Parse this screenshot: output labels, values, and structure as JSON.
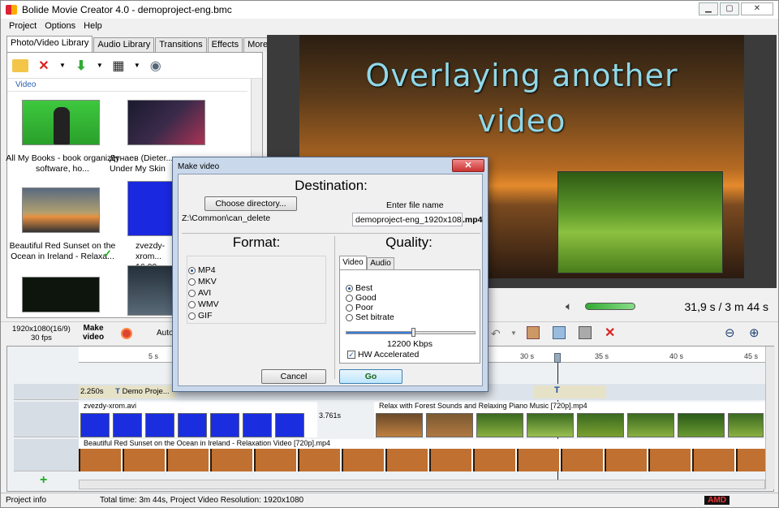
{
  "window": {
    "title": "Bolide Movie Creator 4.0 - demoproject-eng.bmc"
  },
  "menu": [
    "Project",
    "Options",
    "Help"
  ],
  "library": {
    "tabs": [
      "Photo/Video Library",
      "Audio Library",
      "Transitions",
      "Effects",
      "More"
    ],
    "section": "Video",
    "items": [
      {
        "caption": "All My Books - book organizer software, ho..."
      },
      {
        "caption": "Дунаев (Dieter... Under My Skin"
      },
      {
        "caption": "Beautiful Red Sunset on the Ocean in Ireland - Relaxa..."
      },
      {
        "caption": "zvezdy-xrom... 16.00..."
      }
    ]
  },
  "preview": {
    "line1": "Overlaying another",
    "line2": "video",
    "time": "31,9 s  / 3 m 44 s"
  },
  "toolbar": {
    "resolution": "1920x1080(16/9)",
    "fps": "30 fps",
    "make_video": "Make video",
    "auto": "Auto"
  },
  "timeline": {
    "ticks": [
      "5 s",
      "30 s",
      "35 s",
      "40 s",
      "45 s"
    ],
    "text_clip": {
      "dur": "2.250s",
      "label": "Demo Proje..."
    },
    "video_clip1": {
      "name": "zvezdy-xrom.avi",
      "dur": "3.761s"
    },
    "video_clip2": {
      "name": "Relax with Forest Sounds and Relaxing Piano Music [720p].mp4"
    },
    "video_clip3": {
      "name": "Beautiful Red Sunset on the Ocean in Ireland - Relaxation Video [720p].mp4"
    }
  },
  "status": {
    "info": "Project info",
    "total": "Total time: 3m 44s,   Project Video Resolution:  1920x1080",
    "amd": "AMD"
  },
  "dialog": {
    "title": "Make video",
    "destination": "Destination:",
    "choose_dir": "Choose directory...",
    "path": "Z:\\Common\\can_delete",
    "enter_name_label": "Enter file name",
    "file_name": "demoproject-eng_1920x108(",
    "ext": ".mp4",
    "format_title": "Format:",
    "formats": [
      "MP4",
      "MKV",
      "AVI",
      "WMV",
      "GIF"
    ],
    "selected_format": "MP4",
    "quality_title": "Quality:",
    "quality_tabs": [
      "Video",
      "Audio"
    ],
    "qualities": [
      "Best",
      "Good",
      "Poor",
      "Set bitrate"
    ],
    "selected_quality": "Best",
    "bitrate": "12200 Kbps",
    "bitrate_level": 0.52,
    "hw_accel": "HW Accelerated",
    "hw_checked": true,
    "cancel": "Cancel",
    "go": "Go"
  }
}
